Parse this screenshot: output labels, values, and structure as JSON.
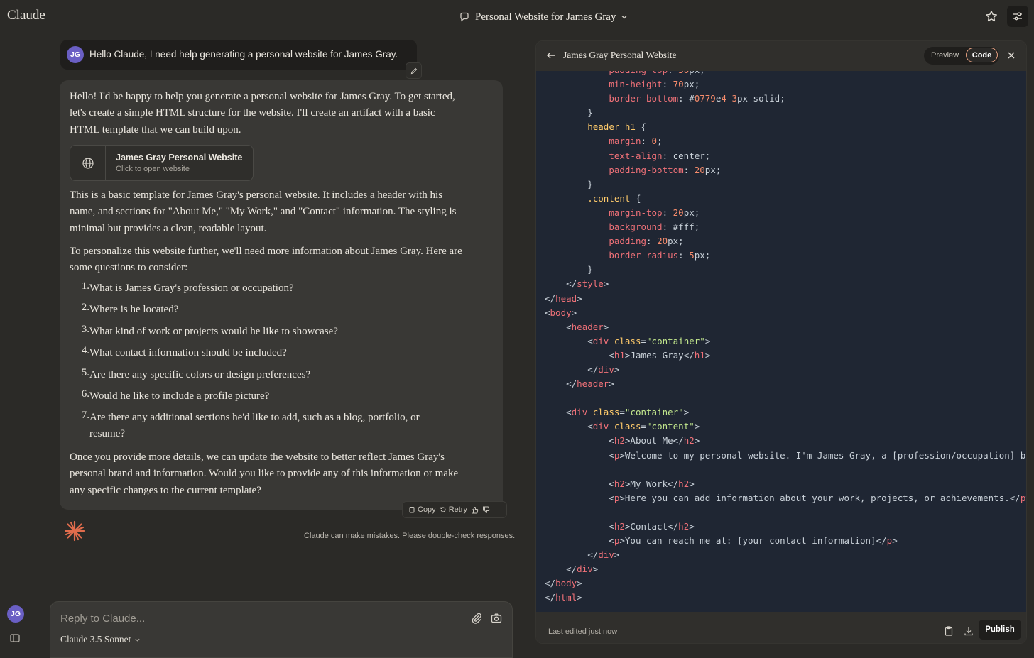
{
  "app": {
    "name": "Claude"
  },
  "conversation": {
    "title": "Personal Website for James Gray"
  },
  "user": {
    "initials": "JG"
  },
  "user_message": {
    "text": "Hello Claude, I need help generating a personal website for James Gray."
  },
  "assistant": {
    "intro": "Hello! I'd be happy to help you generate a personal website for James Gray. To get started, let's create a simple HTML structure for the website. I'll create an artifact with a basic HTML template that we can build upon.",
    "artifact_title": "James Gray Personal Website",
    "artifact_sub": "Click to open website",
    "para2": "This is a basic template for James Gray's personal website. It includes a header with his name, and sections for \"About Me,\" \"My Work,\" and \"Contact\" information. The styling is minimal but provides a clean, readable layout.",
    "para3": "To personalize this website further, we'll need more information about James Gray. Here are some questions to consider:",
    "questions": [
      {
        "num": "1.",
        "text": "What is James Gray's profession or occupation?"
      },
      {
        "num": "2.",
        "text": "Where is he located?"
      },
      {
        "num": "3.",
        "text": "What kind of work or projects would he like to showcase?"
      },
      {
        "num": "4.",
        "text": "What contact information should be included?"
      },
      {
        "num": "5.",
        "text": "Are there any specific colors or design preferences?"
      },
      {
        "num": "6.",
        "text": "Would he like to include a profile picture?"
      },
      {
        "num": "7.",
        "text": "Are there any additional sections he'd like to add, such as a blog, portfolio, or resume?"
      }
    ],
    "outro": "Once you provide more details, we can update the website to better reflect James Gray's personal brand and information. Would you like to provide any of this information or make any specific changes to the current template?",
    "copy_label": "Copy",
    "retry_label": "Retry"
  },
  "disclaimer": "Claude can make mistakes. Please double-check responses.",
  "composer": {
    "placeholder": "Reply to Claude...",
    "model": "Claude 3.5 Sonnet"
  },
  "artifact_panel": {
    "title": "James Gray Personal Website",
    "preview_label": "Preview",
    "code_label": "Code",
    "last_edited": "Last edited just now",
    "publish_label": "Publish",
    "code_lines": [
      "            padding-top: 30px;",
      "            min-height: 70px;",
      "            border-bottom: #0779e4 3px solid;",
      "        }",
      "        header h1 {",
      "            margin: 0;",
      "            text-align: center;",
      "            padding-bottom: 20px;",
      "        }",
      "        .content {",
      "            margin-top: 20px;",
      "            background: #fff;",
      "            padding: 20px;",
      "            border-radius: 5px;",
      "        }",
      "    </style>",
      "</head>",
      "<body>",
      "    <header>",
      "        <div class=\"container\">",
      "            <h1>James Gray</h1>",
      "        </div>",
      "    </header>",
      "",
      "    <div class=\"container\">",
      "        <div class=\"content\">",
      "            <h2>About Me</h2>",
      "            <p>Welcome to my personal website. I'm James Gray, a [profession/occupation] based i",
      "",
      "            <h2>My Work</h2>",
      "            <p>Here you can add information about your work, projects, or achievements.</p>",
      "",
      "            <h2>Contact</h2>",
      "            <p>You can reach me at: [your contact information]</p>",
      "        </div>",
      "    </div>",
      "</body>",
      "</html>"
    ]
  },
  "colors": {
    "background": "#2b2a27",
    "accent": "#e9a282",
    "avatar": "#6a5fc4",
    "code_bg": "#1f2633",
    "logo": "#e06c4c"
  }
}
